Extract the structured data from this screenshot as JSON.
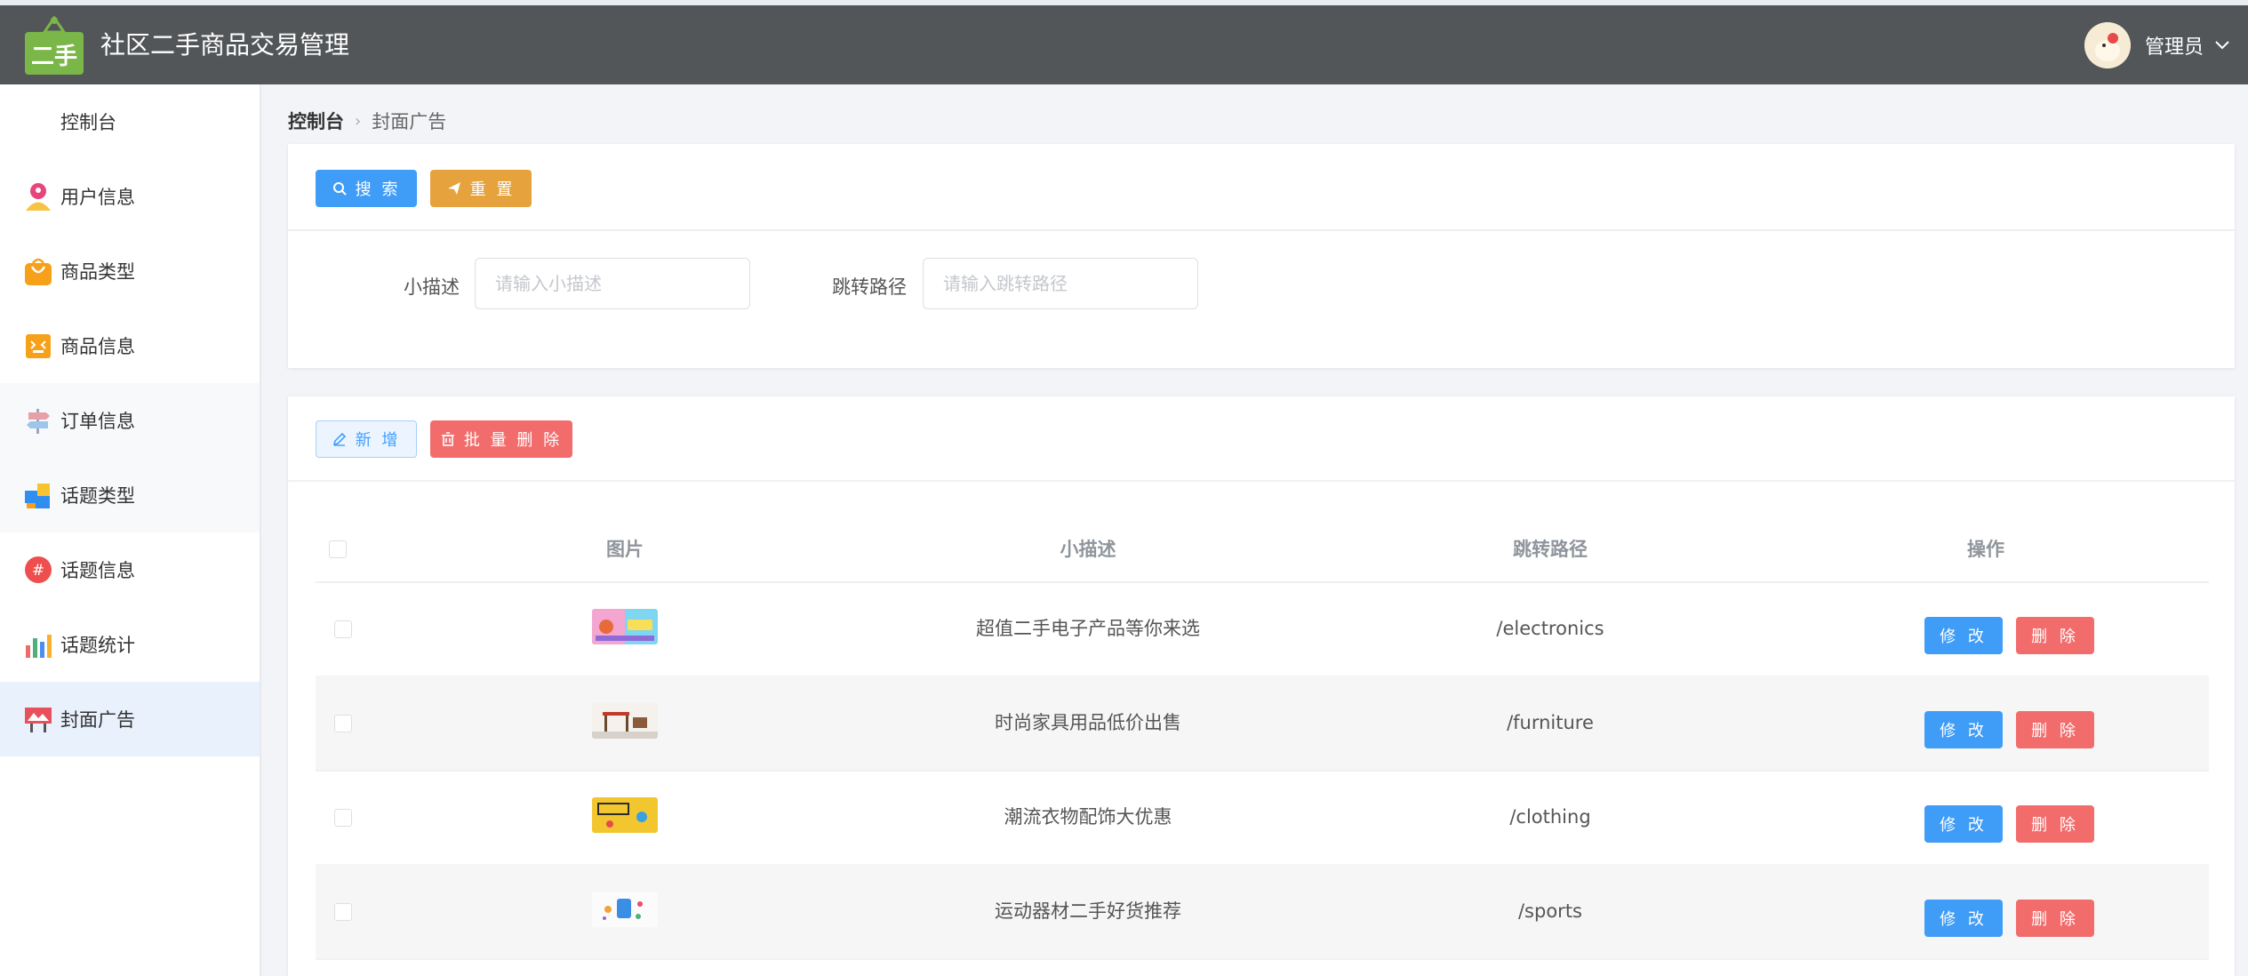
{
  "header": {
    "title": "社区二手商品交易管理",
    "logo_text": "二手",
    "user_name": "管理员"
  },
  "sidebar": {
    "items": [
      {
        "label": "控制台"
      },
      {
        "label": "用户信息"
      },
      {
        "label": "商品类型"
      },
      {
        "label": "商品信息"
      },
      {
        "label": "订单信息"
      },
      {
        "label": "话题类型"
      },
      {
        "label": "话题信息"
      },
      {
        "label": "话题统计"
      },
      {
        "label": "封面广告"
      }
    ]
  },
  "breadcrumb": {
    "home": "控制台",
    "current": "封面广告"
  },
  "search_panel": {
    "search_label": "搜 索",
    "reset_label": "重 置",
    "fields": [
      {
        "label": "小描述",
        "placeholder": "请输入小描述"
      },
      {
        "label": "跳转路径",
        "placeholder": "请输入跳转路径"
      }
    ]
  },
  "toolbar": {
    "add_label": "新 增",
    "batch_delete_label": "批 量 删 除"
  },
  "table": {
    "columns": [
      "图片",
      "小描述",
      "跳转路径",
      "操作"
    ],
    "rows": [
      {
        "desc": "超值二手电子产品等你来选",
        "path": "/electronics"
      },
      {
        "desc": "时尚家具用品低价出售",
        "path": "/furniture"
      },
      {
        "desc": "潮流衣物配饰大优惠",
        "path": "/clothing"
      },
      {
        "desc": "运动器材二手好货推荐",
        "path": "/sports"
      }
    ],
    "edit_label": "修 改",
    "delete_label": "删 除"
  },
  "colors": {
    "header_bg": "#535659",
    "primary": "#3f9cf7",
    "warning": "#e6a23c",
    "danger": "#f36c6c"
  }
}
